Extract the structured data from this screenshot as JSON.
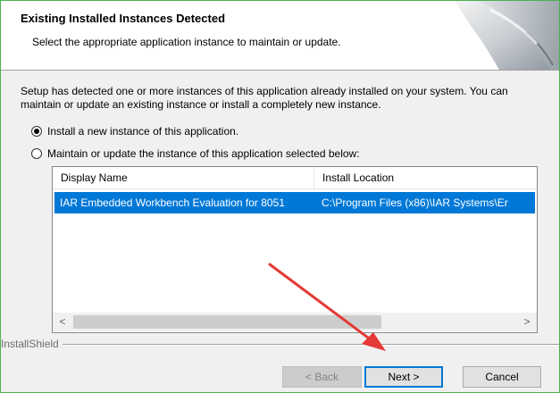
{
  "header": {
    "title": "Existing Installed Instances Detected",
    "subtitle": "Select the appropriate application instance to maintain or update."
  },
  "body": {
    "description": "Setup has detected one or more instances of this application already installed on your system. You can maintain or update an existing instance or install a completely new instance."
  },
  "options": [
    {
      "label": "Install a new instance of this application.",
      "selected": true
    },
    {
      "label": "Maintain or update the instance of this application selected below:",
      "selected": false
    }
  ],
  "list": {
    "columns": [
      "Display Name",
      "Install Location"
    ],
    "rows": [
      {
        "display_name": "IAR Embedded Workbench Evaluation for 8051",
        "install_location": "C:\\Program Files (x86)\\IAR Systems\\Er",
        "selected": true
      }
    ],
    "scroll_left": "<",
    "scroll_right": ">"
  },
  "footer": {
    "brand": "InstallShield",
    "back_label": "< Back",
    "next_label": "Next >",
    "cancel_label": "Cancel"
  },
  "colors": {
    "selection": "#0078d7",
    "annotation_arrow": "#e53935",
    "frame_border": "#4caf50"
  }
}
